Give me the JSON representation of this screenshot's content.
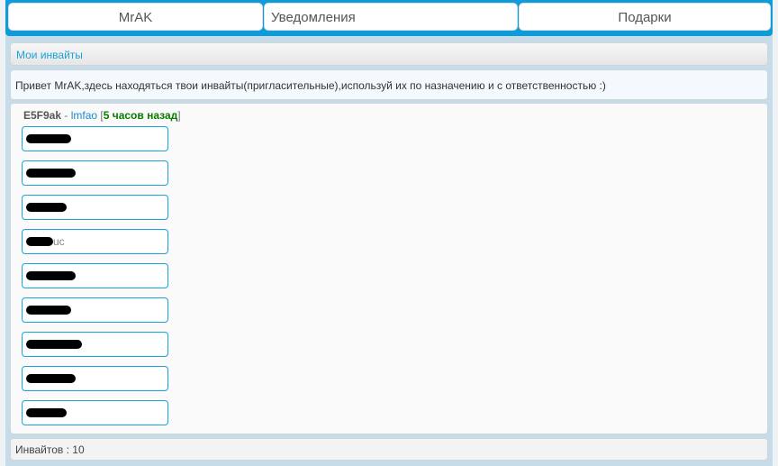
{
  "tabs": [
    {
      "label": "MrAK"
    },
    {
      "label": "Уведомления"
    },
    {
      "label": "Подарки"
    }
  ],
  "section_title": "Мои инвайты",
  "greeting": "Привет MrAK,здесь находяться твои инвайты(пригласительные),используй их по назначению и с ответственностью :)",
  "invite_group": {
    "code": "E5F9ak",
    "separator": " - ",
    "user": "lmfao",
    "bracket_open": "[",
    "time": "5 часов назад",
    "bracket_close": "]"
  },
  "invites": [
    {
      "value": "",
      "redacted": true
    },
    {
      "value": "",
      "redacted": true
    },
    {
      "value": "",
      "redacted": true
    },
    {
      "value": "uc",
      "redacted": true
    },
    {
      "value": "",
      "redacted": true
    },
    {
      "value": "",
      "redacted": true
    },
    {
      "value": "",
      "redacted": true
    },
    {
      "value": "",
      "redacted": true
    },
    {
      "value": "",
      "redacted": true
    }
  ],
  "footer": "Инвайтов : 10"
}
